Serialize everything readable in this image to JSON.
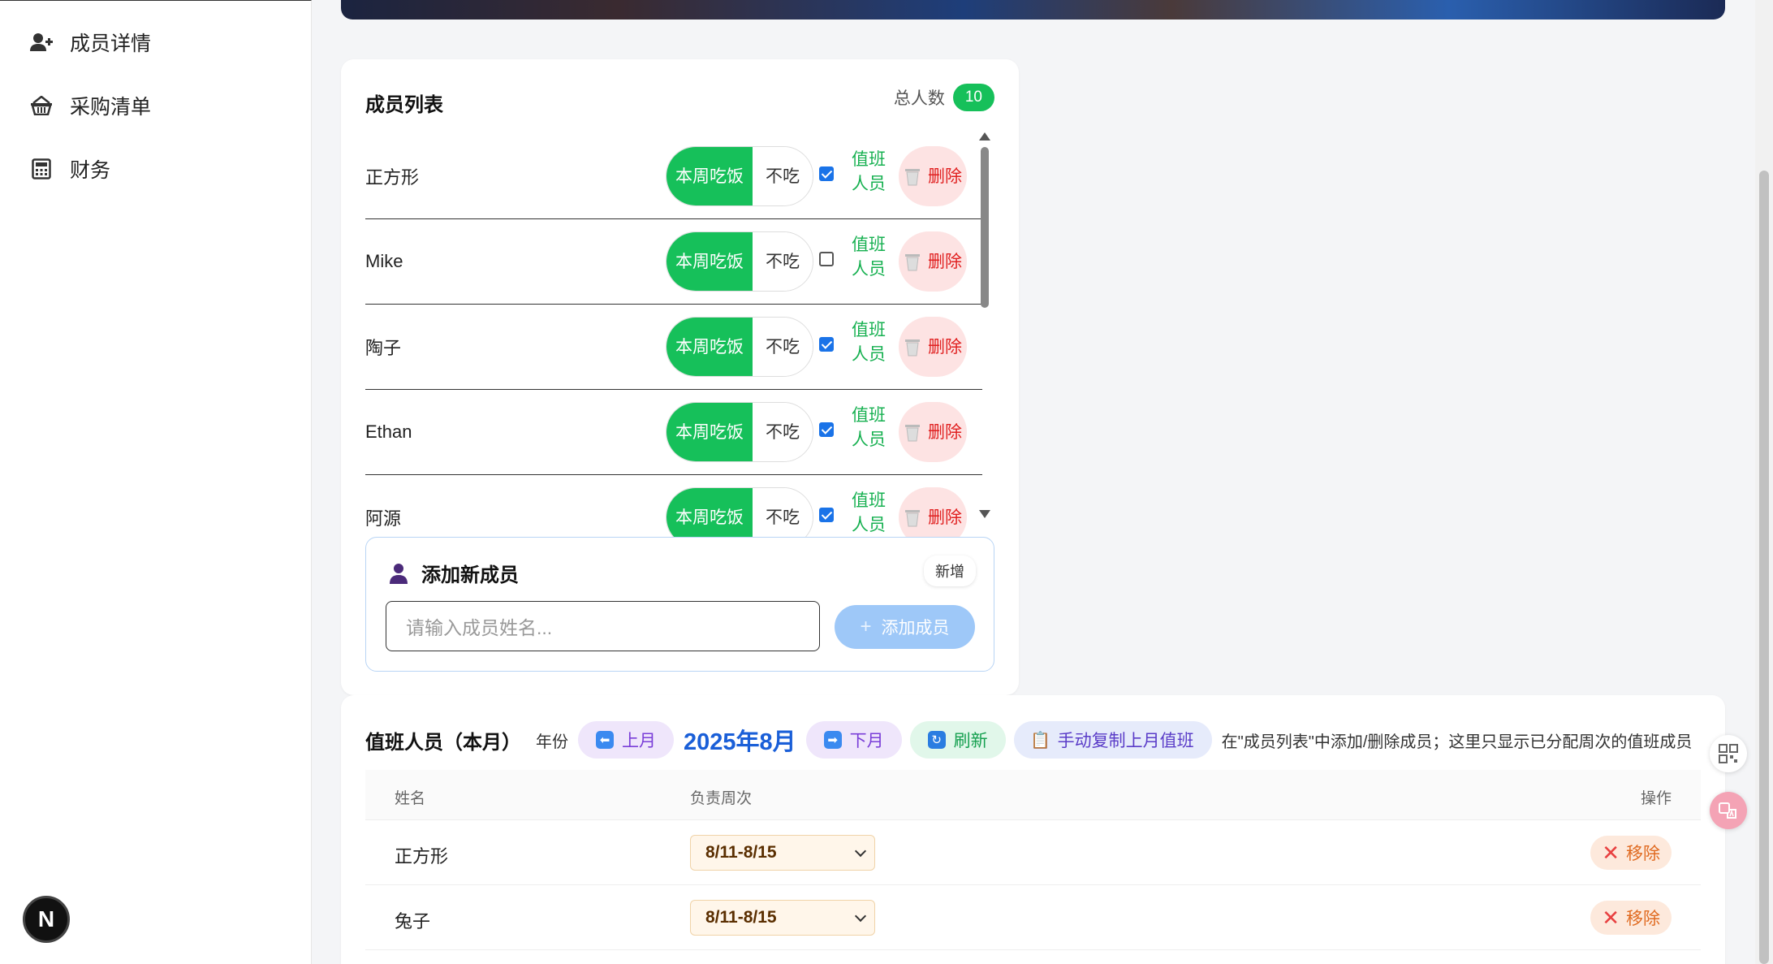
{
  "sidebar": {
    "items": [
      {
        "label": "成员详情",
        "icon": "user-plus-icon"
      },
      {
        "label": "采购清单",
        "icon": "basket-icon"
      },
      {
        "label": "财务",
        "icon": "calculator-icon"
      }
    ],
    "logo_letter": "N"
  },
  "members": {
    "title": "成员列表",
    "total_label": "总人数",
    "total": "10",
    "toggle_on": "本周吃饭",
    "toggle_off": "不吃",
    "duty_label": "值班人员",
    "delete_label": "删除",
    "rows": [
      {
        "name": "正方形",
        "duty": true
      },
      {
        "name": "Mike",
        "duty": false
      },
      {
        "name": "陶子",
        "duty": true
      },
      {
        "name": "Ethan",
        "duty": true
      },
      {
        "name": "阿源",
        "duty": true
      }
    ]
  },
  "add_member": {
    "title": "添加新成员",
    "tag": "新增",
    "placeholder": "请输入成员姓名...",
    "button": "添加成员"
  },
  "duty": {
    "title": "值班人员（本月）",
    "year_label": "年份",
    "prev": "上月",
    "month": "2025年8月",
    "next": "下月",
    "refresh": "刷新",
    "copy": "手动复制上月值班",
    "hint": "在\"成员列表\"中添加/删除成员；这里只显示已分配周次的值班成员",
    "columns": {
      "name": "姓名",
      "week": "负责周次",
      "action": "操作"
    },
    "rows": [
      {
        "name": "正方形",
        "week": "8/11-8/15",
        "action": "移除"
      },
      {
        "name": "兔子",
        "week": "8/11-8/15",
        "action": "移除"
      }
    ]
  },
  "colors": {
    "accent_green": "#16c05a",
    "month_blue": "#1a5fd8",
    "delete_red": "#e02020"
  }
}
